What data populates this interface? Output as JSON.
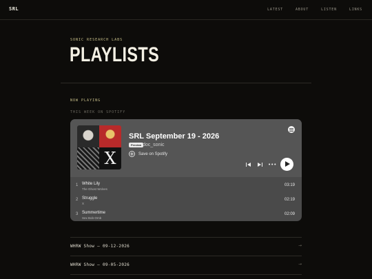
{
  "header": {
    "logo": "SRL",
    "nav": [
      "LATEST",
      "ABOUT",
      "LISTEN",
      "LINKS"
    ]
  },
  "page": {
    "eyebrow": "SONIC RESEARCH LABS",
    "title": "PLAYLISTS",
    "now_playing": "NOW PLAYING",
    "this_week": "THIS WEEK ON SPOTIFY"
  },
  "embed": {
    "title": "SRL September 19 - 2026",
    "badge": "Preview",
    "owner": "doc_sonic",
    "save_label": "Save on Spotify",
    "more_glyph": "•••",
    "cover_letter": "X",
    "tracks": [
      {
        "num": "1",
        "name": "White Lily",
        "artist": "The Ghost Wolves",
        "duration": "03:19"
      },
      {
        "num": "2",
        "name": "Struggle",
        "artist": "X",
        "duration": "02:19"
      },
      {
        "num": "3",
        "name": "Summertime",
        "artist": "Sex Bob-Omb",
        "duration": "02:09"
      }
    ]
  },
  "shows": [
    {
      "label": "WHRW Show — 09-12-2026",
      "arrow": "→"
    },
    {
      "label": "WHRW Show — 09-05-2026",
      "arrow": "→"
    }
  ],
  "colors": {
    "background": "#0d0c0a",
    "accent": "#c9c08a",
    "embed_bg": "#555555"
  }
}
